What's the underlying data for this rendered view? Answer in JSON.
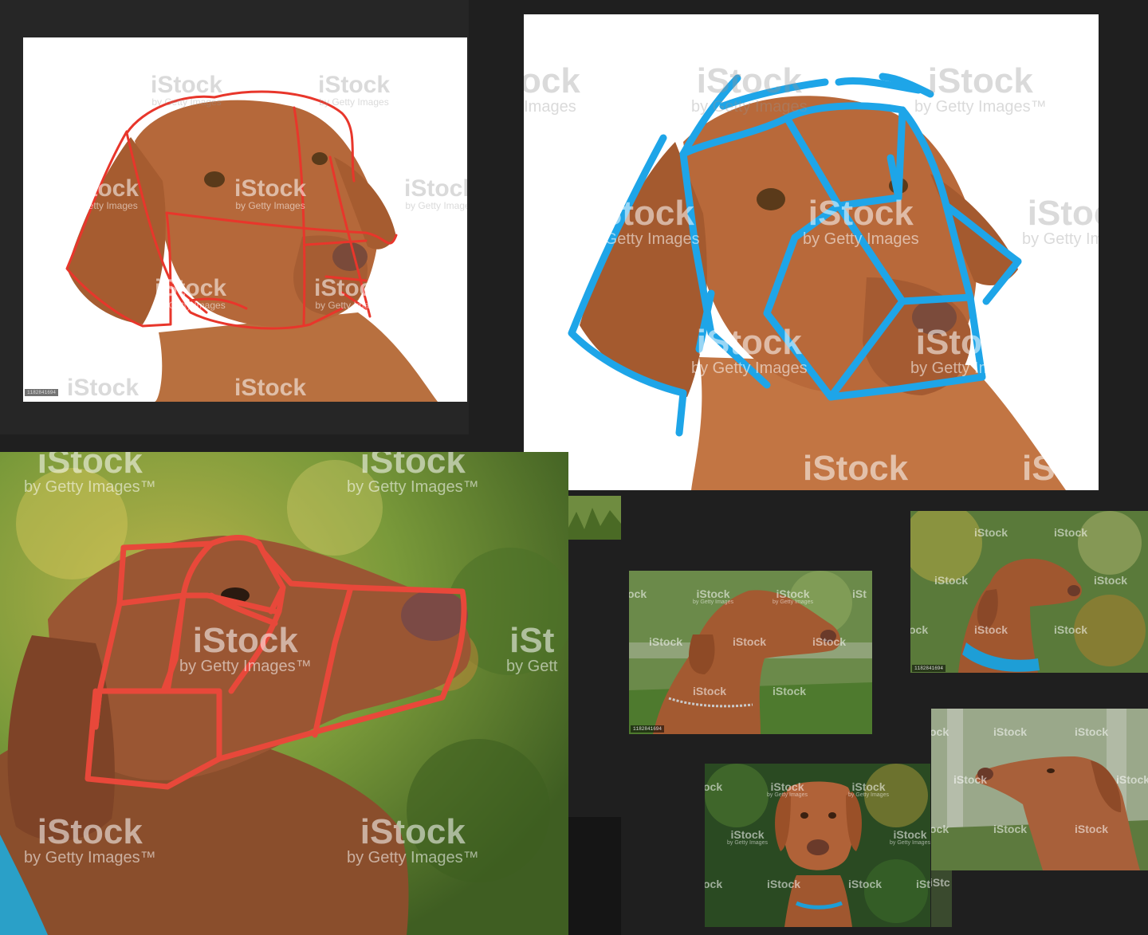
{
  "watermark": {
    "brand": "iStock",
    "byline": "by Getty Images",
    "byline_tm": "by Getty Images™",
    "partial_brand": "ock",
    "partial_brand_2": "iSt",
    "partial_brand_3": "iStc",
    "partial_byline": "by Gett"
  },
  "image_id": "1182841694",
  "colors": {
    "background": "#1f1f1f",
    "red_overlay": "#e8362b",
    "blue_overlay": "#1ea5e8",
    "dog_coat": "#b5683a"
  },
  "panels": [
    {
      "name": "studio-dog-red-sketch",
      "overlay": "red"
    },
    {
      "name": "studio-dog-blue-sketch",
      "overlay": "blue"
    },
    {
      "name": "garden-dog-profile-red-sketch",
      "overlay": "red"
    },
    {
      "name": "reference-dog-side-chain-collar",
      "overlay": "none"
    },
    {
      "name": "reference-dog-blue-collar-upward",
      "overlay": "none"
    },
    {
      "name": "reference-dog-front-facing",
      "overlay": "none"
    },
    {
      "name": "reference-dog-looking-up",
      "overlay": "none"
    }
  ]
}
